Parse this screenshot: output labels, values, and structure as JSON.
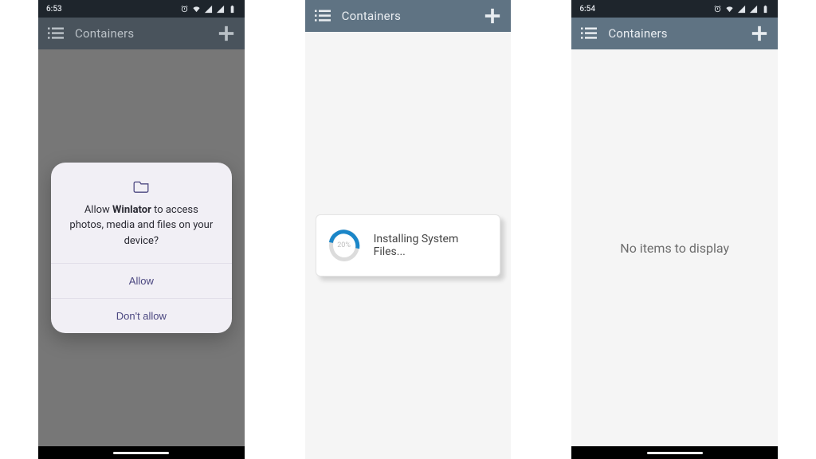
{
  "screens": [
    {
      "status_time": "6:53",
      "appbar_title": "Containers",
      "dialog": {
        "prompt_prefix": "Allow ",
        "app_name": "Winlator",
        "prompt_suffix": " to access photos, media and files on your device?",
        "allow_label": "Allow",
        "deny_label": "Don't allow"
      }
    },
    {
      "appbar_title": "Containers",
      "progress": {
        "percent_label": "20%",
        "status_text": "Installing System Files..."
      }
    },
    {
      "status_time": "6:54",
      "appbar_title": "Containers",
      "empty_text": "No items to display"
    }
  ],
  "icons": {
    "list": "list-icon",
    "add": "plus-icon",
    "folder": "folder-icon",
    "alarm": "alarm-icon",
    "wifi": "wifi-icon",
    "signal": "signal-icon",
    "battery": "battery-icon"
  }
}
